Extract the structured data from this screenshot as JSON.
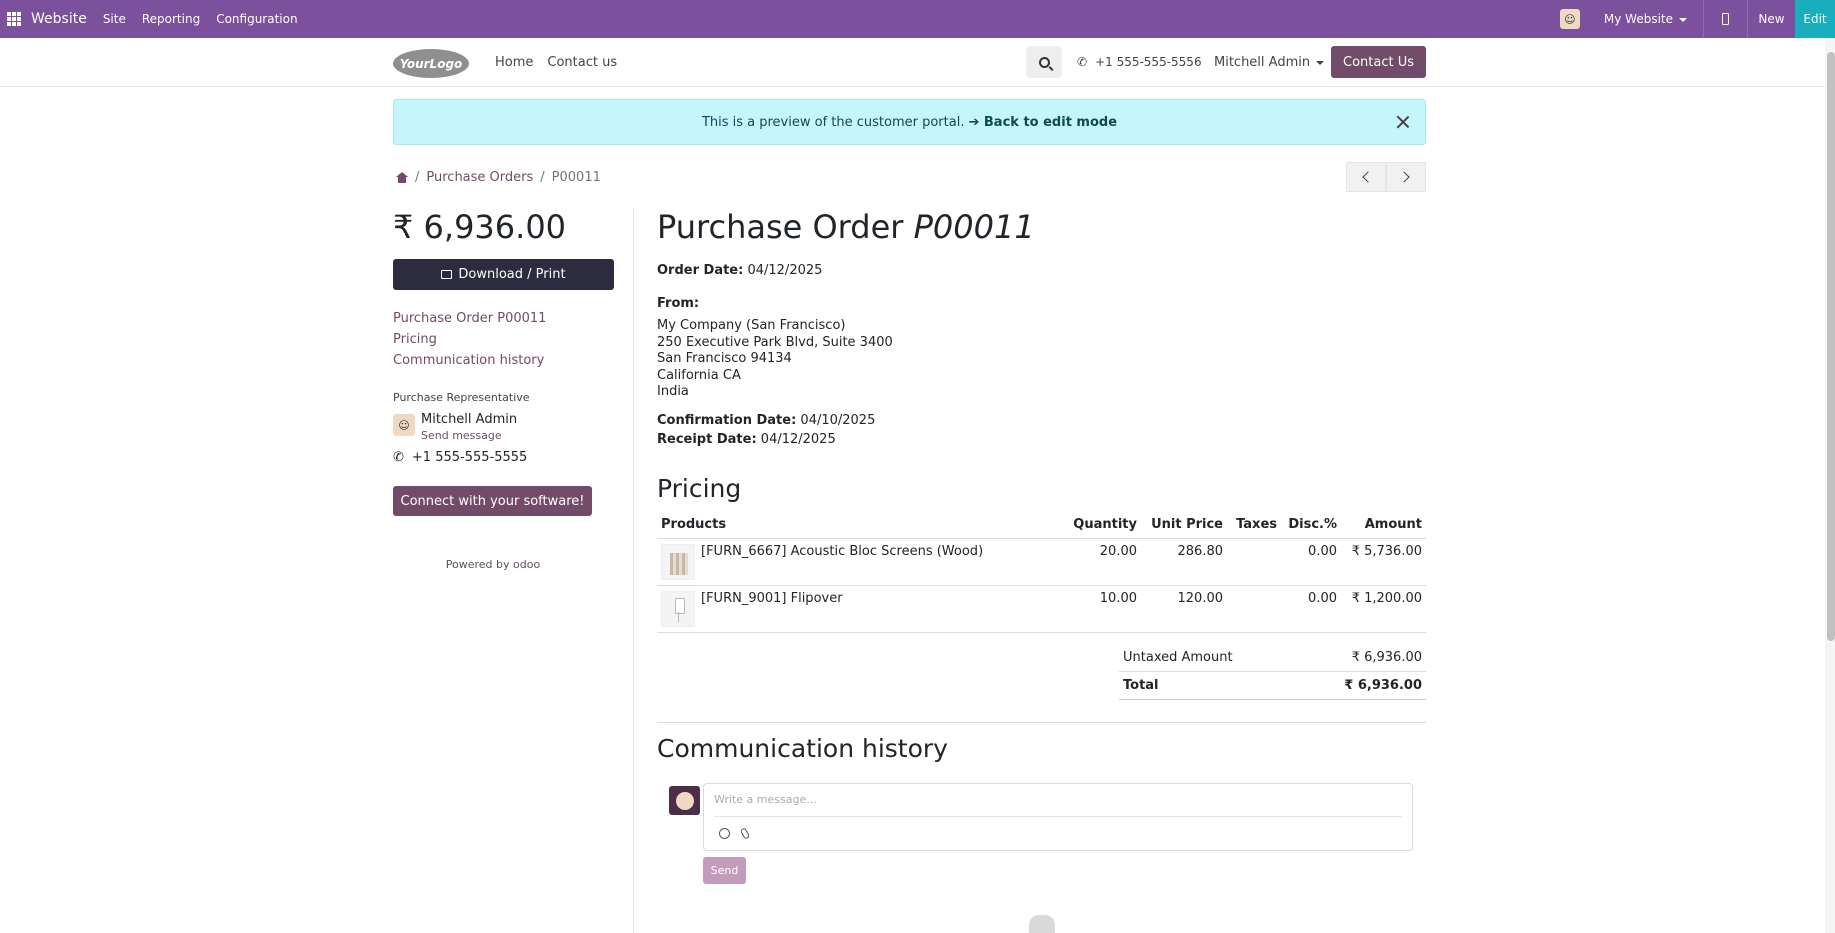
{
  "adminbar": {
    "brand": "Website",
    "menu": [
      "Site",
      "Reporting",
      "Configuration"
    ],
    "website_selector": "My Website",
    "new_label": "New",
    "edit_label": "Edit"
  },
  "header": {
    "logo_text": "YourLogo",
    "nav": [
      "Home",
      "Contact us"
    ],
    "phone": "+1 555-555-5556",
    "user": "Mitchell Admin",
    "contact_button": "Contact Us"
  },
  "alert": {
    "text": "This is a preview of the customer portal.",
    "link": "➔ Back to edit mode"
  },
  "breadcrumb": {
    "sep": "/",
    "parent": "Purchase Orders",
    "current": "P00011"
  },
  "sidebar": {
    "total": "₹ 6,936.00",
    "download_label": "Download / Print",
    "toc": [
      "Purchase Order P00011",
      "Pricing",
      "Communication history"
    ],
    "rep_label": "Purchase Representative",
    "rep_name": "Mitchell Admin",
    "rep_send": "Send message",
    "rep_phone": "+1 555-555-5555",
    "connect_label": "Connect with your software!",
    "powered_by": "Powered by",
    "powered_brand": "odoo"
  },
  "order": {
    "title_prefix": "Purchase Order",
    "title_ref": "P00011",
    "order_date_label": "Order Date:",
    "order_date": "04/12/2025",
    "from_label": "From:",
    "address": [
      "My Company (San Francisco)",
      "250 Executive Park Blvd, Suite 3400",
      "San Francisco 94134",
      "California CA",
      "India"
    ],
    "confirmation_label": "Confirmation Date:",
    "confirmation_date": "04/10/2025",
    "receipt_label": "Receipt Date:",
    "receipt_date": "04/12/2025"
  },
  "pricing": {
    "heading": "Pricing",
    "columns": [
      "Products",
      "Quantity",
      "Unit Price",
      "Taxes",
      "Disc.%",
      "Amount"
    ],
    "lines": [
      {
        "product": "[FURN_6667] Acoustic Bloc Screens (Wood)",
        "qty": "20.00",
        "unit": "286.80",
        "taxes": "",
        "disc": "0.00",
        "amount": "₹ 5,736.00"
      },
      {
        "product": "[FURN_9001] Flipover",
        "qty": "10.00",
        "unit": "120.00",
        "taxes": "",
        "disc": "0.00",
        "amount": "₹ 1,200.00"
      }
    ],
    "untaxed_label": "Untaxed Amount",
    "untaxed_value": "₹ 6,936.00",
    "total_label": "Total",
    "total_value": "₹ 6,936.00"
  },
  "communication": {
    "heading": "Communication history",
    "placeholder": "Write a message...",
    "send_label": "Send"
  }
}
